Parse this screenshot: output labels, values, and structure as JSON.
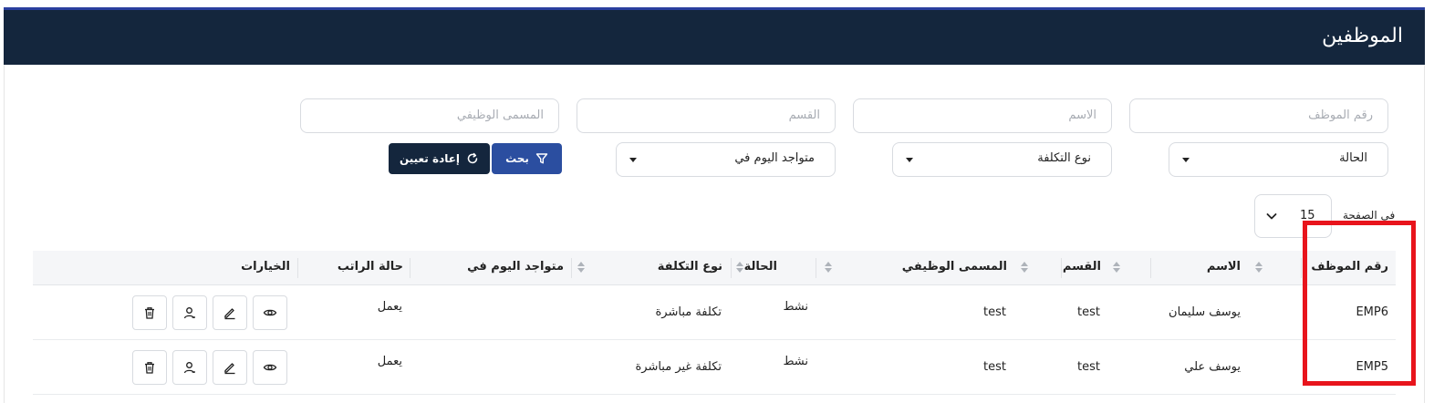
{
  "page": {
    "title": "الموظفين"
  },
  "filters": {
    "employee_id_placeholder": "رقم الموظف",
    "name_placeholder": "الاسم",
    "department_placeholder": "القسم",
    "job_title_placeholder": "المسمى الوظيفي",
    "status_value": "الحالة",
    "cost_type_value": "نوع التكلفة",
    "present_today_value": "متواجد اليوم في",
    "search_label": "بحث",
    "reset_label": "إعادة تعيين"
  },
  "pagination": {
    "per_page_label": "في الصفحة",
    "per_page_value": "15"
  },
  "table": {
    "headers": {
      "employee_id": "رقم الموظف",
      "name": "الاسم",
      "department": "القسم",
      "job_title": "المسمى الوظيفي",
      "status": "الحالة",
      "cost_type": "نوع التكلفة",
      "present_today": "متواجد اليوم في",
      "salary_status": "حالة الراتب",
      "options": "الخيارات"
    },
    "rows": [
      {
        "employee_id": "EMP6",
        "name": "يوسف سليمان",
        "department": "test",
        "job_title": "test",
        "status": "نشط",
        "cost_type": "تكلفة مباشرة",
        "present_today": "",
        "salary_status": "يعمل"
      },
      {
        "employee_id": "EMP5",
        "name": "يوسف علي",
        "department": "test",
        "job_title": "test",
        "status": "نشط",
        "cost_type": "تكلفة غير مباشرة",
        "present_today": "",
        "salary_status": "يعمل"
      }
    ]
  },
  "colors": {
    "header_bg": "#14263d",
    "primary": "#2b4ea0",
    "highlight": "#e8141c"
  }
}
